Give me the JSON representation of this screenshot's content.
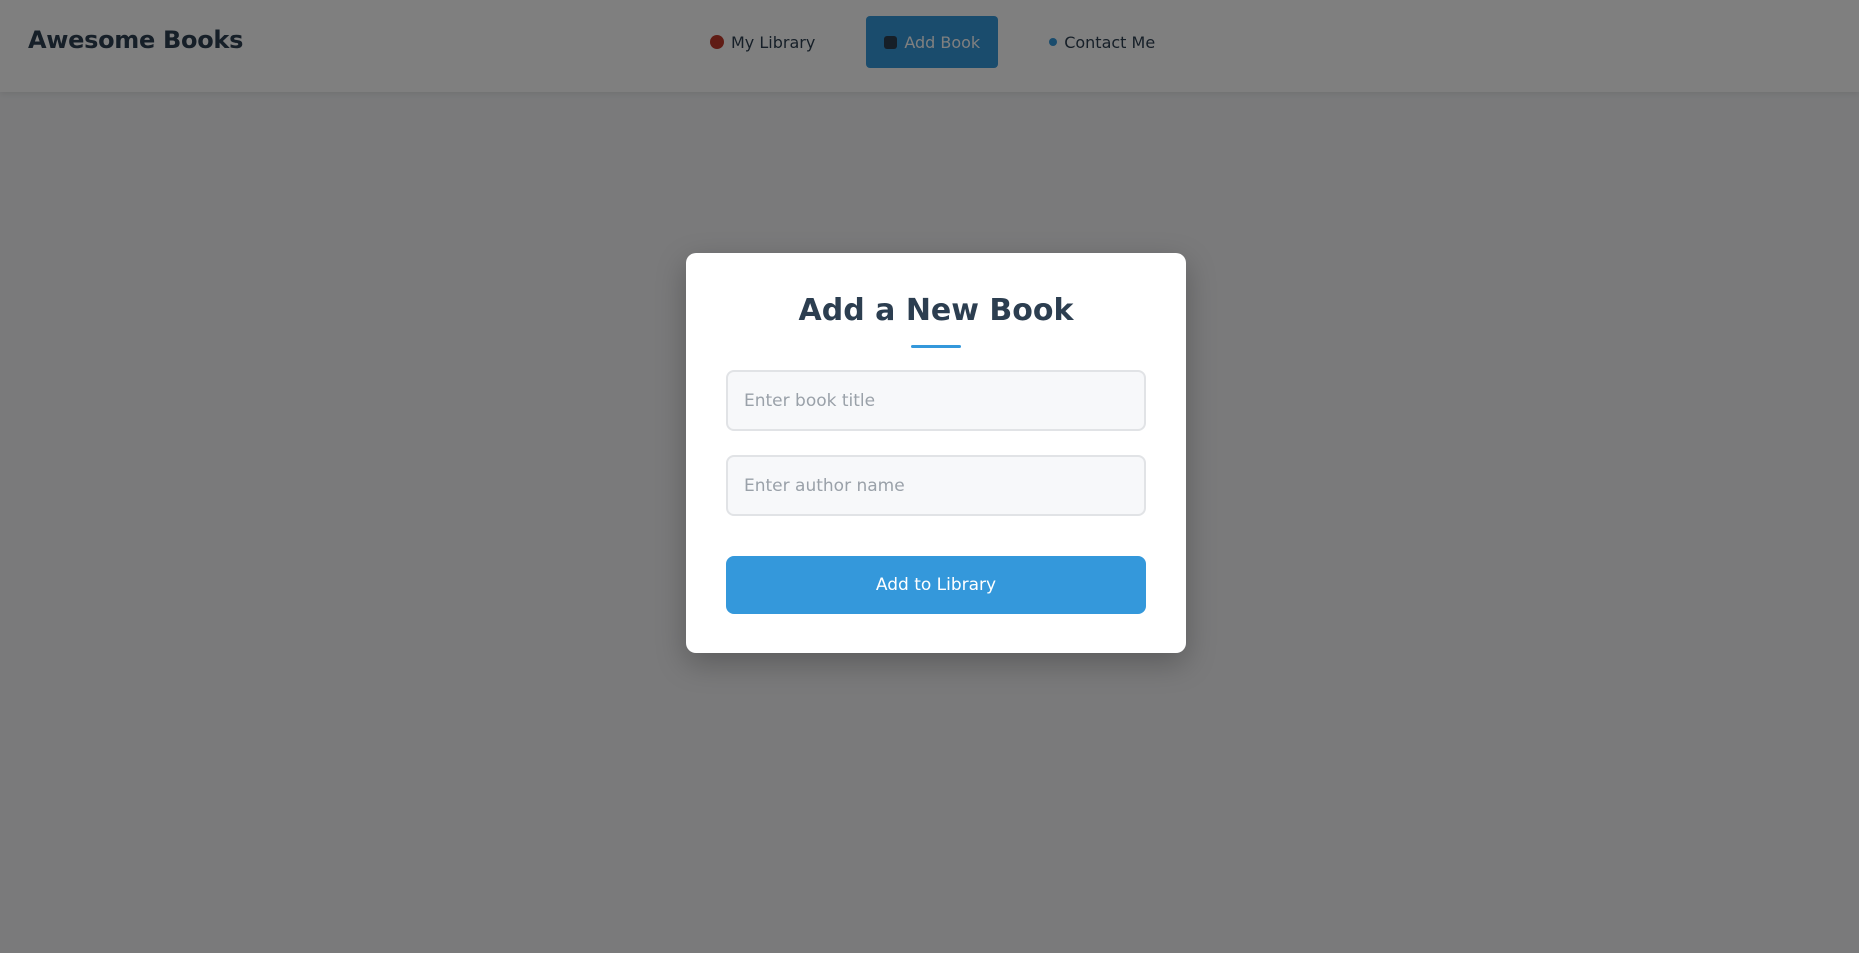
{
  "header": {
    "brand": "Awesome Books",
    "nav": [
      {
        "label": "My Library",
        "icon": "books-icon",
        "active": false
      },
      {
        "label": "Add Book",
        "icon": "plus-icon",
        "active": true
      },
      {
        "label": "Contact Me",
        "icon": "mail-icon",
        "active": false
      }
    ]
  },
  "modal": {
    "title": "Add a New Book",
    "title_input_placeholder": "Enter book title",
    "author_input_placeholder": "Enter author name",
    "submit_label": "Add to Library"
  },
  "colors": {
    "accent": "#3498db",
    "text_dark": "#2c3e50",
    "overlay": "rgba(0,0,0,0.5)"
  }
}
